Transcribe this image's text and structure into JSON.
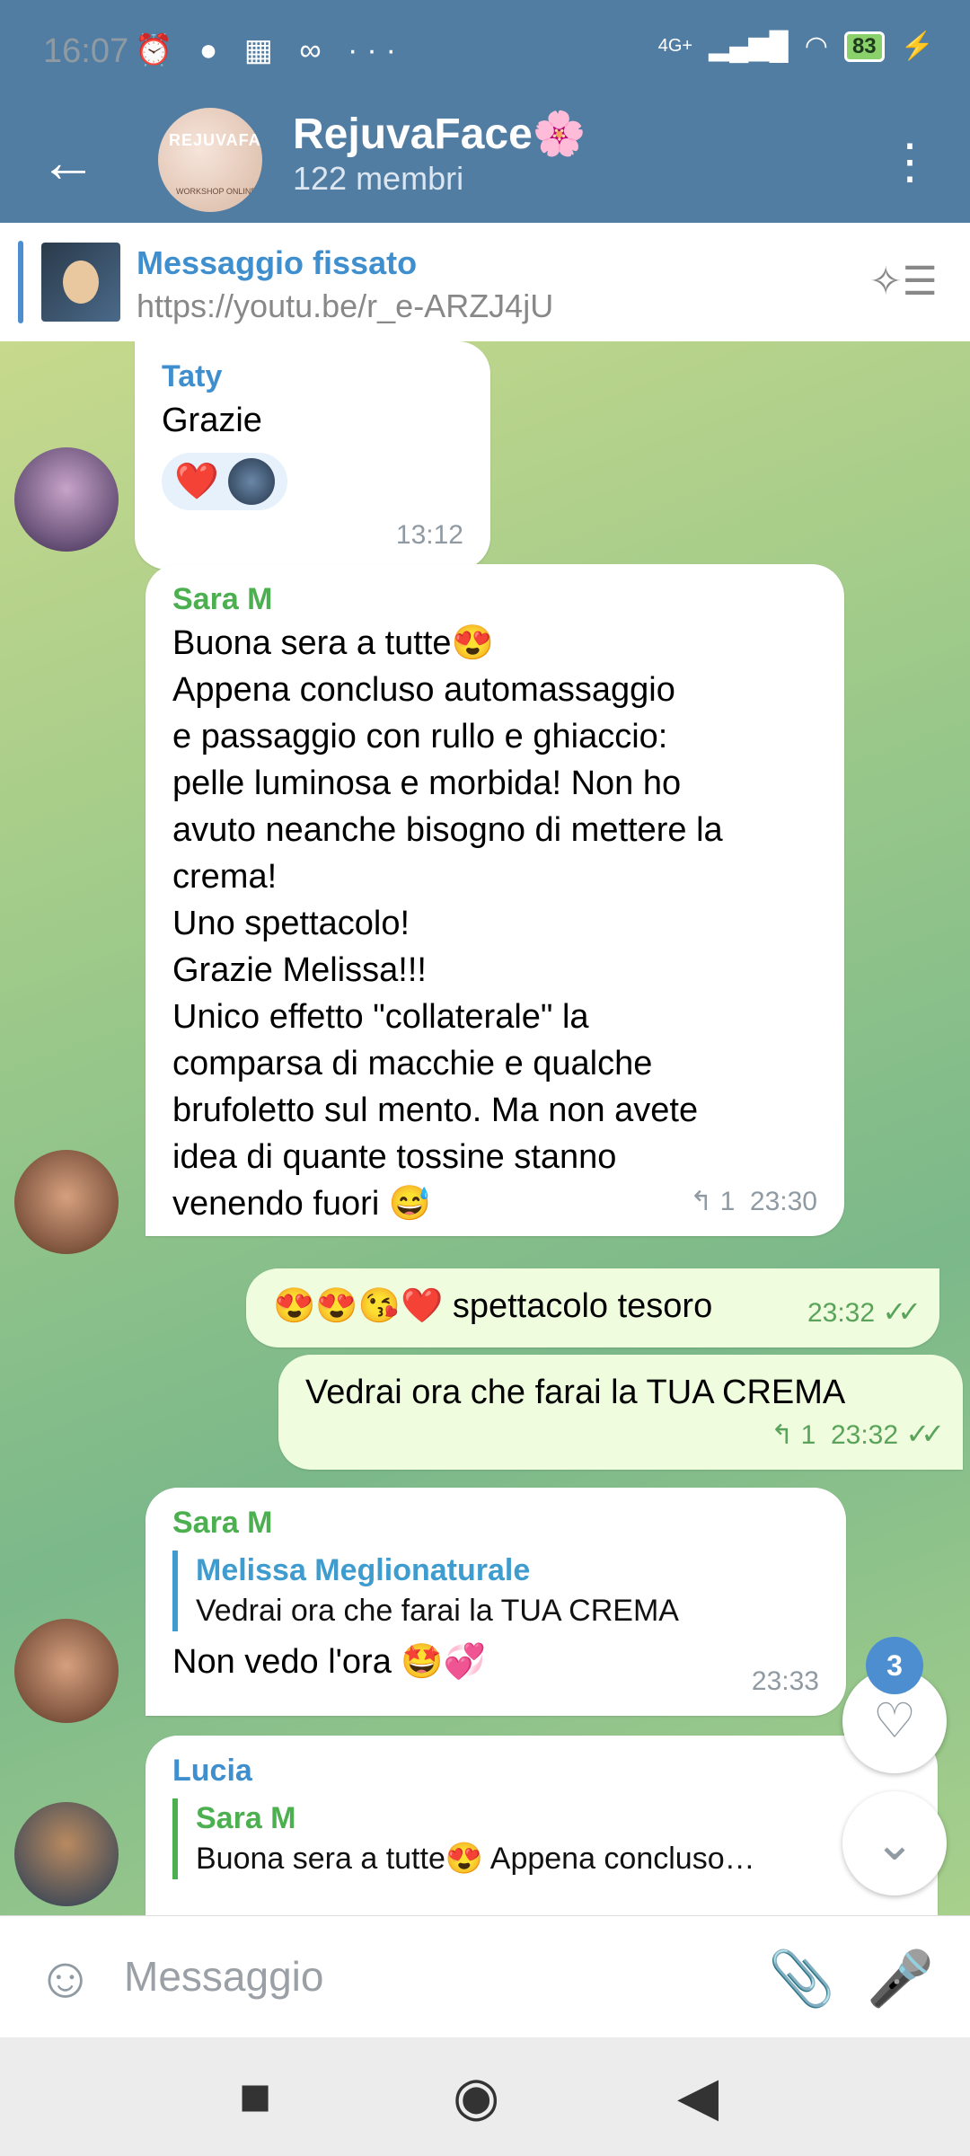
{
  "status_bar": {
    "time": "16:07",
    "left_icons": "⏰ ● ▦ ∞ ···",
    "network": "4G+",
    "battery": "83"
  },
  "header": {
    "title": "RejuvaFace🌸",
    "subtitle": "122 membri",
    "avatar_text": "REJUVAFACE",
    "avatar_sub": "WORKSHOP ONLINE"
  },
  "pinned": {
    "title": "Messaggio fissato",
    "link": "https://youtu.be/r_e-ARZJ4jU"
  },
  "messages": [
    {
      "sender": "Taty",
      "text": "Grazie",
      "time": "13:12",
      "reaction": "❤️"
    },
    {
      "sender": "Sara M",
      "lines": [
        "Buona sera a tutte😍",
        "Appena concluso automassaggio",
        "e passaggio con rullo e ghiaccio:",
        "pelle luminosa e morbida! Non ho",
        "avuto neanche bisogno di mettere la",
        "crema!",
        "Uno spettacolo!",
        "Grazie Melissa!!!",
        "Unico effetto \"collaterale\" la",
        "comparsa di macchie e qualche",
        "brufoletto sul mento. Ma non avete",
        "idea di quante tossine stanno",
        "venendo fuori 😅"
      ],
      "reply_count": "↰ 1",
      "time": "23:30"
    },
    {
      "text": "😍😍😘❤️ spettacolo tesoro",
      "time": "23:32"
    },
    {
      "text": "Vedrai ora che farai la TUA CREMA",
      "reply_count": "↰ 1",
      "time": "23:32"
    },
    {
      "sender": "Sara M",
      "reply_name": "Melissa Meglionaturale",
      "reply_text": "Vedrai ora che farai la TUA CREMA",
      "text": "Non vedo l'ora 🤩💞",
      "time": "23:33"
    },
    {
      "sender": "Lucia",
      "reply_name": "Sara M",
      "reply_text": "Buona sera a tutte😍 Appena concluso…"
    }
  ],
  "fab": {
    "unread_count": "3",
    "reactions_icon": "heart-icon",
    "scroll_icon": "chevron-down-icon"
  },
  "input": {
    "placeholder": "Messaggio"
  },
  "colors": {
    "header": "#527da3",
    "accent": "#4c8ed0",
    "outgoing": "#effdde"
  }
}
